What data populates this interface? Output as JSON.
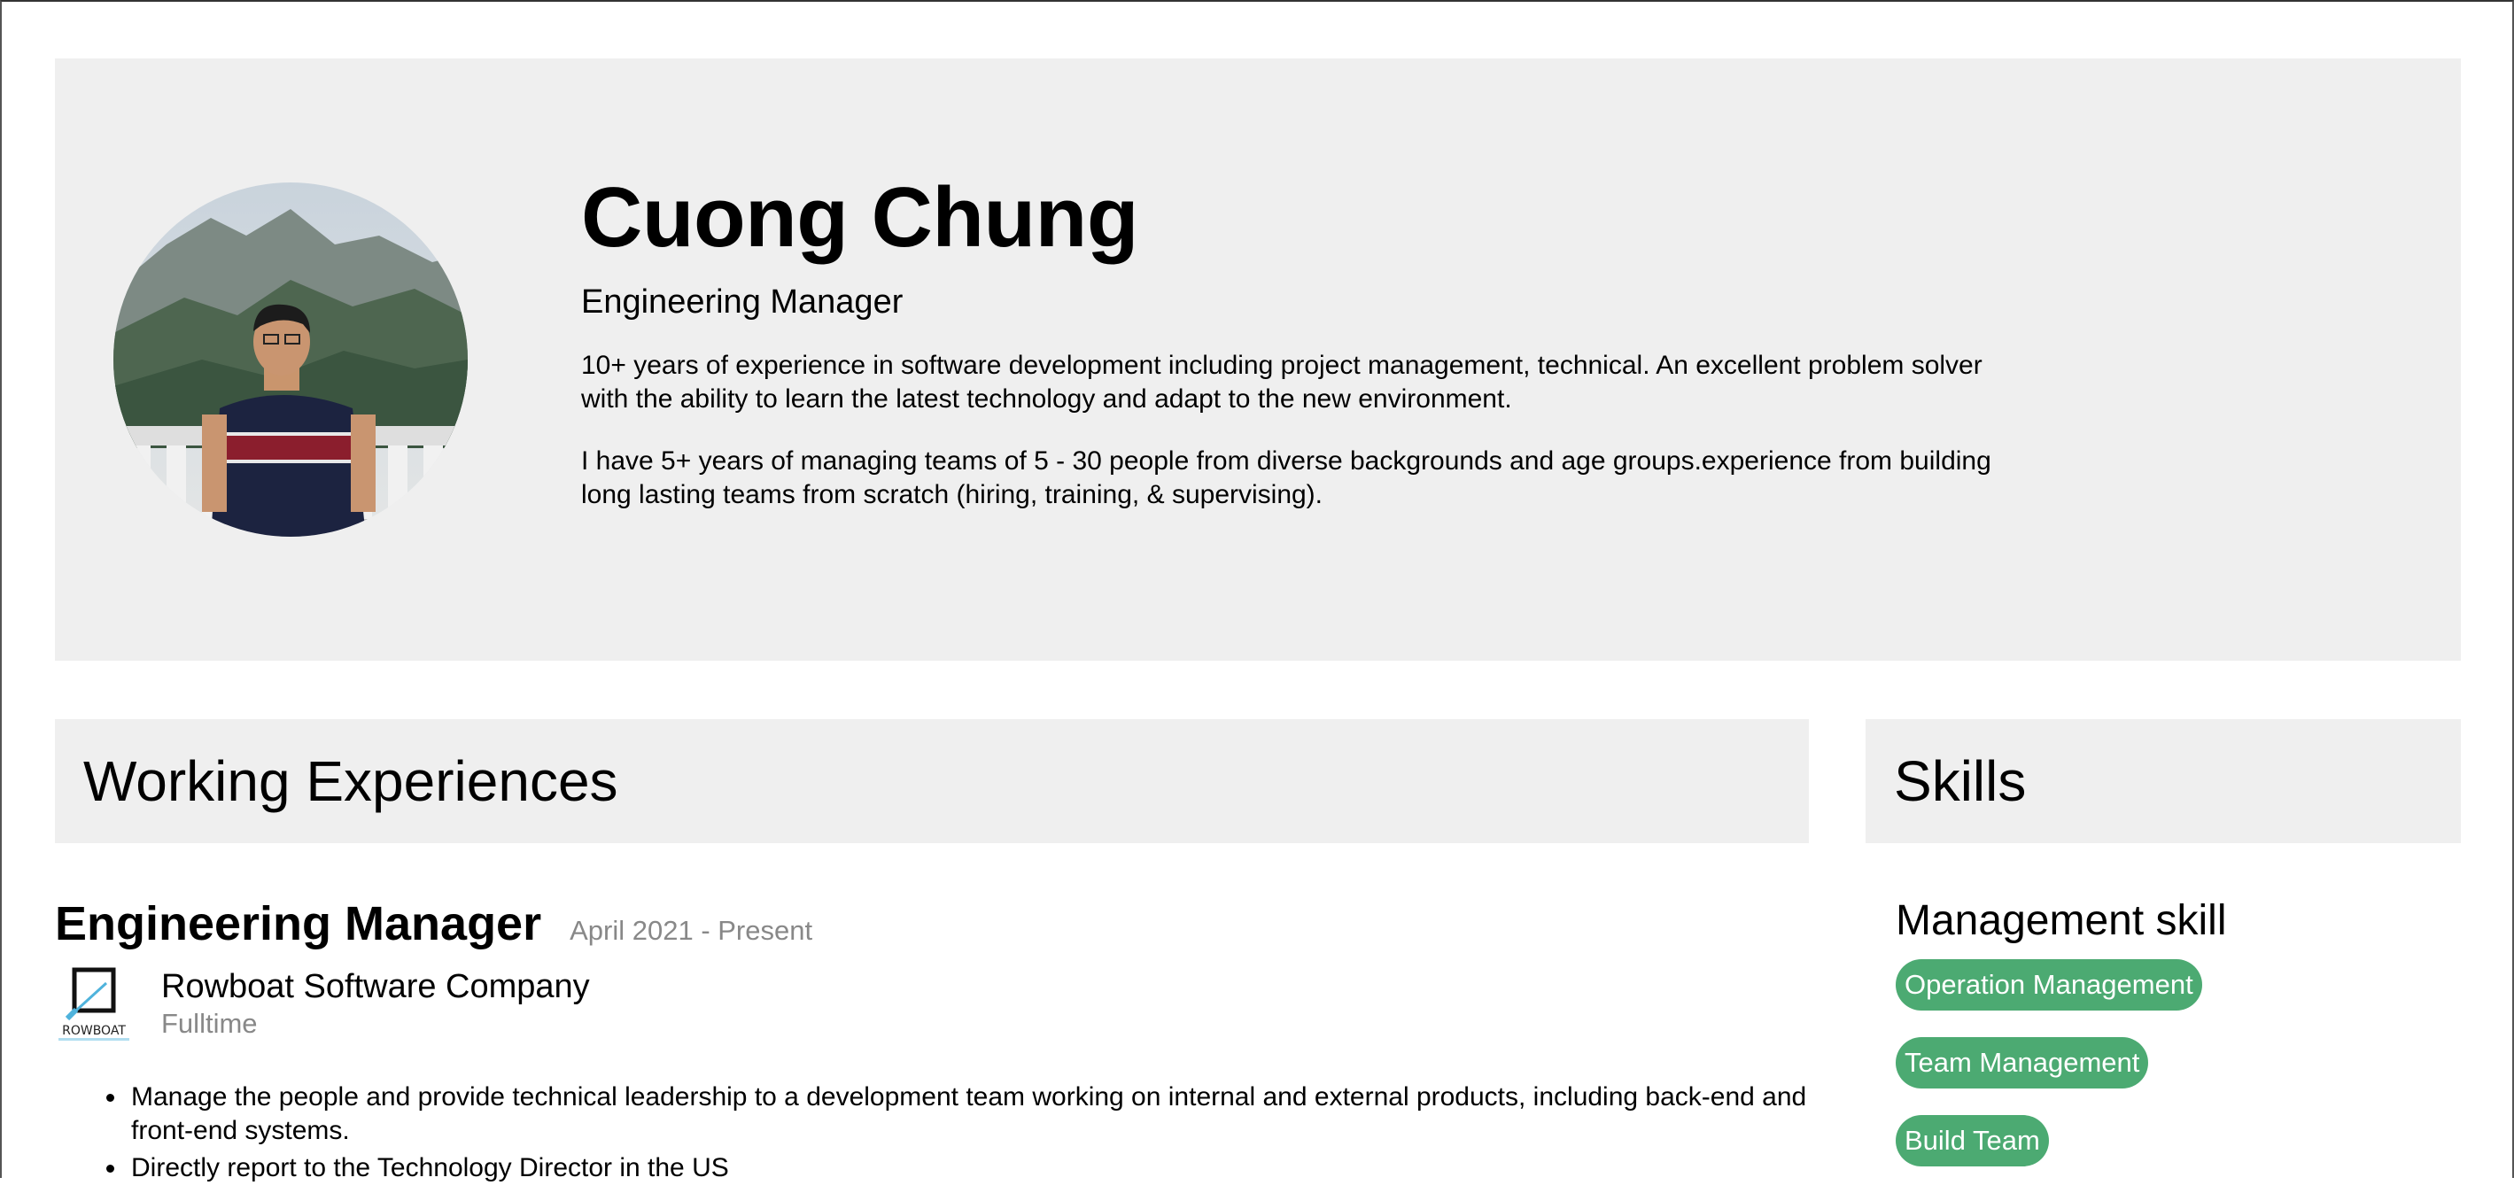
{
  "profile": {
    "name": "Cuong Chung",
    "title": "Engineering Manager",
    "bio": [
      "10+ years of experience in software development including project management, technical. An excellent problem solver with the ability to learn the latest technology and adapt to the new environment.",
      "I have 5+ years of managing teams of 5 - 30 people from diverse backgrounds and age groups.experience from building long lasting teams from scratch (hiring, training, & supervising)."
    ]
  },
  "sections": {
    "experience_title": "Working Experiences",
    "skills_title": "Skills"
  },
  "experience": [
    {
      "title": "Engineering Manager",
      "date": "April 2021 - Present",
      "company": "Rowboat Software Company",
      "company_logo_text": "ROWBOAT",
      "type": "Fulltime",
      "duties": [
        "Manage the people and provide technical leadership to a development team working on internal and external products, including back-end and front-end systems.",
        "Directly report to the Technology Director in the US"
      ]
    }
  ],
  "skills": [
    {
      "group": "Management skill",
      "items": [
        "Operation Management",
        "Team Management",
        "Build Team"
      ]
    }
  ],
  "colors": {
    "panel_background": "#efefef",
    "tag_background": "#4caa72",
    "muted_text": "#888888"
  }
}
